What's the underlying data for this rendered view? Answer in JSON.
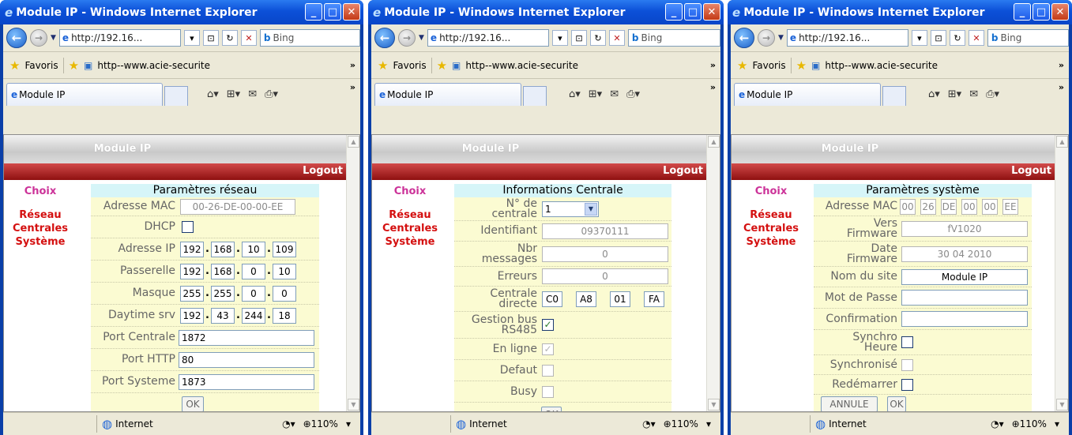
{
  "window_title": "Module IP - Windows Internet Explorer",
  "address": "http://192.16...",
  "search_placeholder": "Bing",
  "favorites_label": "Favoris",
  "favorite_link": "http--www.acie-securite",
  "tab_label": "Module IP",
  "page_header": "Module IP",
  "logout_label": "Logout",
  "status_zone": "Internet",
  "zoom": "110%",
  "menu": {
    "title": "Choix",
    "items": [
      "Réseau",
      "Centrales",
      "Système"
    ]
  },
  "ok_label": "OK",
  "reseau": {
    "title": "Paramètres réseau",
    "mac_label": "Adresse MAC",
    "mac_value": "00-26-DE-00-00-EE",
    "dhcp_label": "DHCP",
    "ip_label": "Adresse IP",
    "ip": [
      "192",
      "168",
      "10",
      "109"
    ],
    "gateway_label": "Passerelle",
    "gateway": [
      "192",
      "168",
      "0",
      "10"
    ],
    "mask_label": "Masque",
    "mask": [
      "255",
      "255",
      "0",
      "0"
    ],
    "daytime_label": "Daytime srv",
    "daytime": [
      "192",
      "43",
      "244",
      "18"
    ],
    "port_centrale_label": "Port Centrale",
    "port_centrale": "1872",
    "port_http_label": "Port HTTP",
    "port_http": "80",
    "port_systeme_label": "Port Systeme",
    "port_systeme": "1873"
  },
  "centrale": {
    "title": "Informations Centrale",
    "num_label_1": "N° de",
    "num_label_2": "centrale",
    "num_value": "1",
    "ident_label": "Identifiant",
    "ident_value": "09370111",
    "nbr_label_1": "Nbr",
    "nbr_label_2": "messages",
    "nbr_value": "0",
    "err_label": "Erreurs",
    "err_value": "0",
    "direct_label_1": "Centrale",
    "direct_label_2": "directe",
    "direct": [
      "C0",
      "A8",
      "01",
      "FA"
    ],
    "bus_label_1": "Gestion bus",
    "bus_label_2": "RS485",
    "online_label": "En ligne",
    "defaut_label": "Defaut",
    "busy_label": "Busy"
  },
  "systeme": {
    "title": "Paramètres système",
    "mac_label": "Adresse MAC",
    "mac": [
      "00",
      "26",
      "DE",
      "00",
      "00",
      "EE"
    ],
    "fw_label_1": "Vers",
    "fw_label_2": "Firmware",
    "fw_value": "fV1020",
    "date_label_1": "Date",
    "date_label_2": "Firmware",
    "date_value": "30 04 2010",
    "site_label": "Nom du site",
    "site_value": "Module IP",
    "pass_label": "Mot de Passe",
    "confirm_label": "Confirmation",
    "sync_label_1": "Synchro",
    "sync_label_2": "Heure",
    "synced_label": "Synchronisé",
    "restart_label": "Redémarrer",
    "cancel_label": "ANNULE"
  }
}
